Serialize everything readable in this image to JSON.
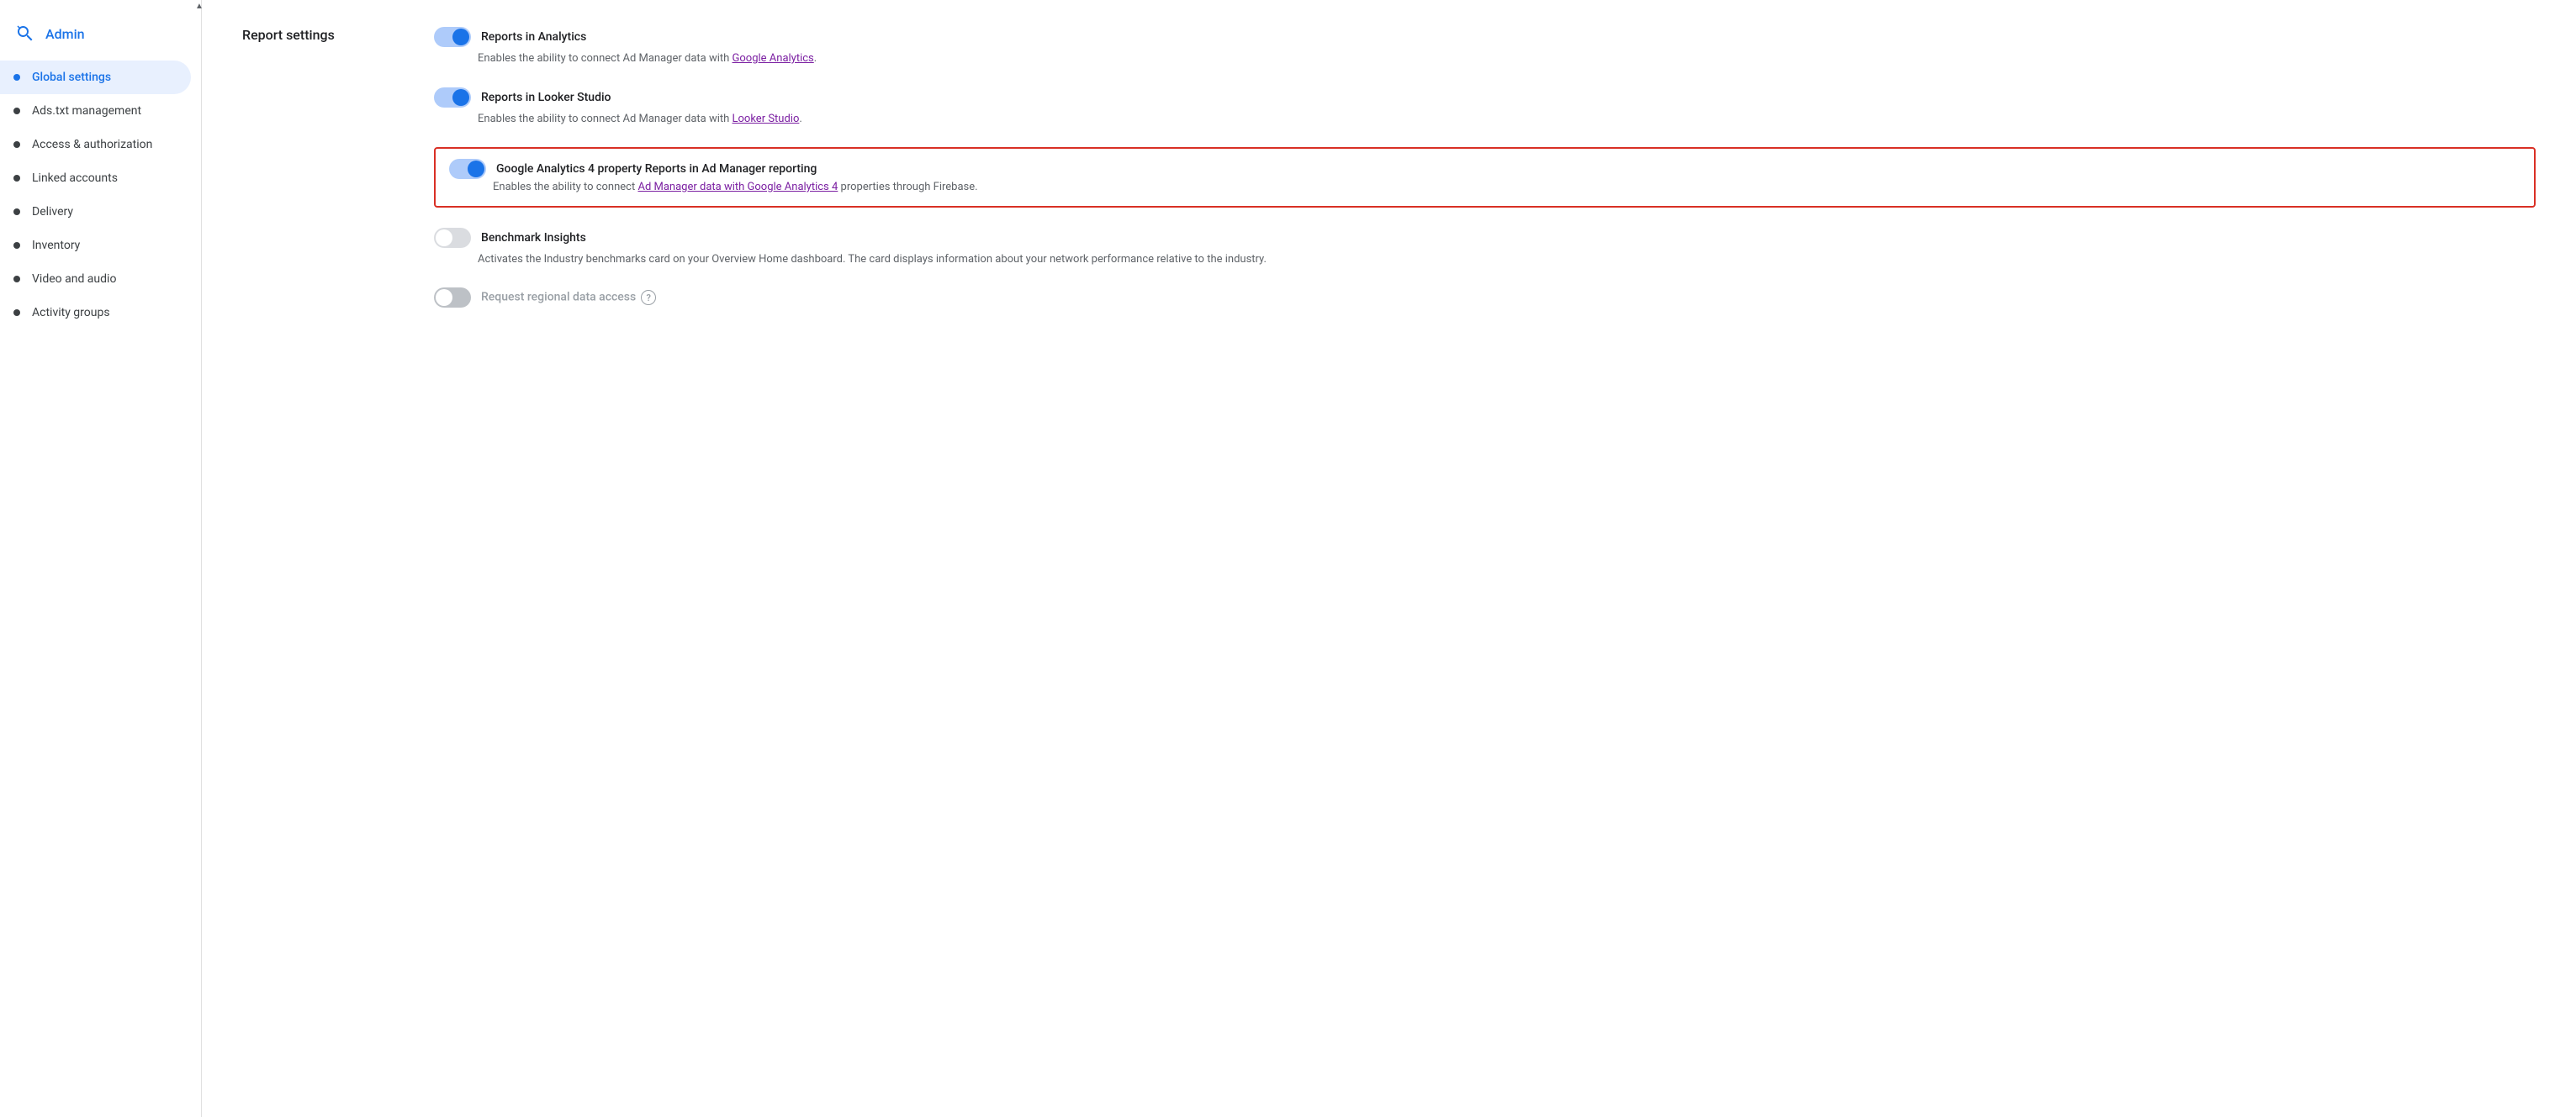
{
  "sidebar": {
    "admin_label": "Admin",
    "items": [
      {
        "id": "global-settings",
        "label": "Global settings",
        "active": true
      },
      {
        "id": "ads-txt-management",
        "label": "Ads.txt management",
        "active": false
      },
      {
        "id": "access-authorization",
        "label": "Access & authorization",
        "active": false
      },
      {
        "id": "linked-accounts",
        "label": "Linked accounts",
        "active": false
      },
      {
        "id": "delivery",
        "label": "Delivery",
        "active": false
      },
      {
        "id": "inventory",
        "label": "Inventory",
        "active": false
      },
      {
        "id": "video-and-audio",
        "label": "Video and audio",
        "active": false
      },
      {
        "id": "activity-groups",
        "label": "Activity groups",
        "active": false
      }
    ]
  },
  "main": {
    "section_title": "Report settings",
    "settings": [
      {
        "id": "reports-in-analytics",
        "label": "Reports in Analytics",
        "enabled": true,
        "description_text": "Enables the ability to connect Ad Manager data with ",
        "link_text": "Google Analytics",
        "description_suffix": ".",
        "highlighted": false
      },
      {
        "id": "reports-in-looker-studio",
        "label": "Reports in Looker Studio",
        "enabled": true,
        "description_text": "Enables the ability to connect Ad Manager data with ",
        "link_text": "Looker Studio",
        "description_suffix": ".",
        "highlighted": false
      },
      {
        "id": "ga4-reports",
        "label": "Google Analytics 4 property Reports in Ad Manager reporting",
        "enabled": true,
        "description_text": "Enables the ability to connect ",
        "link_text": "Ad Manager data with Google Analytics 4",
        "description_suffix": " properties through Firebase.",
        "highlighted": true
      },
      {
        "id": "benchmark-insights",
        "label": "Benchmark Insights",
        "enabled": false,
        "description_text": "Activates the Industry benchmarks card on your Overview Home dashboard. The card displays information about your network performance relative to the industry.",
        "link_text": "",
        "description_suffix": "",
        "highlighted": false
      },
      {
        "id": "request-regional-data-access",
        "label": "Request regional data access",
        "enabled": false,
        "disabled_style": true,
        "has_help": true,
        "description_text": "",
        "highlighted": false
      }
    ]
  }
}
